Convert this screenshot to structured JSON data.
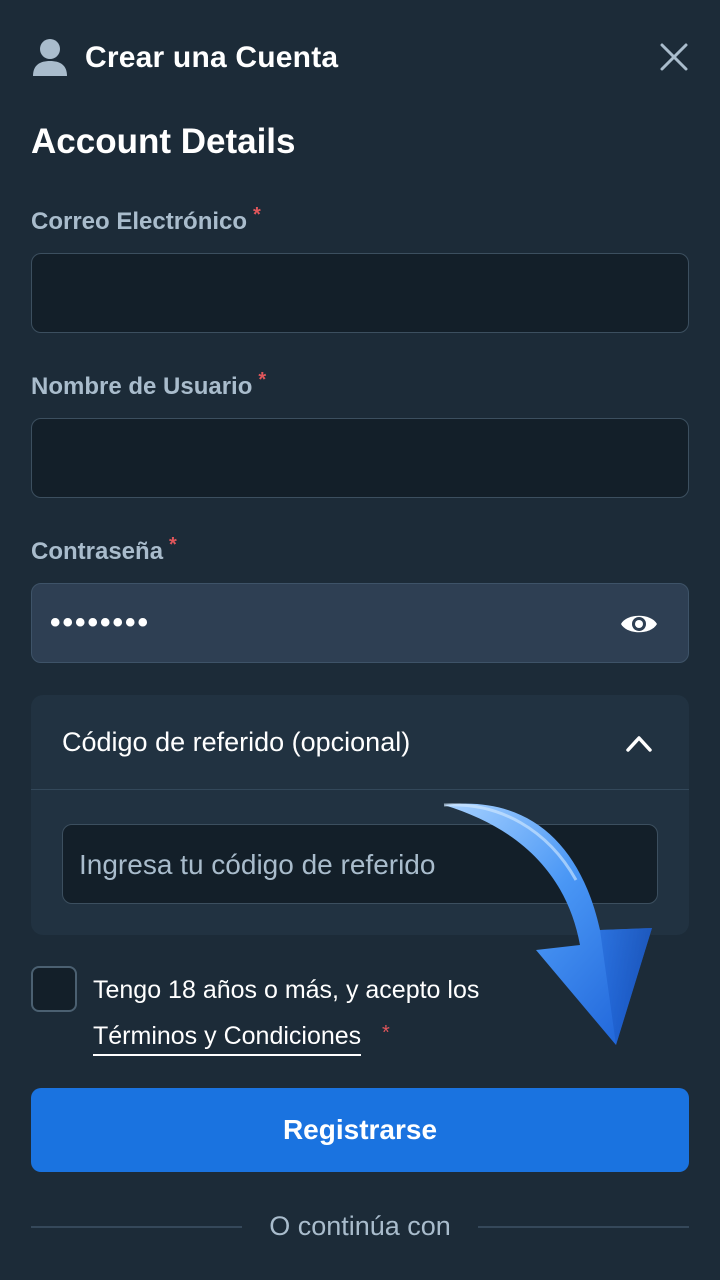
{
  "header": {
    "title": "Crear una Cuenta",
    "icon": "user-icon",
    "close_icon": "close-icon"
  },
  "section_title": "Account Details",
  "fields": {
    "email": {
      "label": "Correo Electrónico",
      "required_mark": "*",
      "value": ""
    },
    "username": {
      "label": "Nombre de Usuario",
      "required_mark": "*",
      "value": ""
    },
    "password": {
      "label": "Contraseña",
      "required_mark": "*",
      "value": "••••••••",
      "icon": "eye-icon"
    }
  },
  "referral": {
    "label": "Código de referido (opcional)",
    "expanded": true,
    "placeholder": "Ingresa tu código de referido",
    "icon": "chevron-up-icon"
  },
  "terms": {
    "checked": false,
    "text": "Tengo 18 años o más, y acepto los",
    "link": "Términos y Condiciones",
    "required_mark": "*"
  },
  "register_button": "Registrarse",
  "divider_text": "O continúa con",
  "colors": {
    "background": "#1c2b38",
    "input_bg": "#131f29",
    "primary": "#1a73e0",
    "required": "#e0565b",
    "label": "#a9bccc"
  }
}
